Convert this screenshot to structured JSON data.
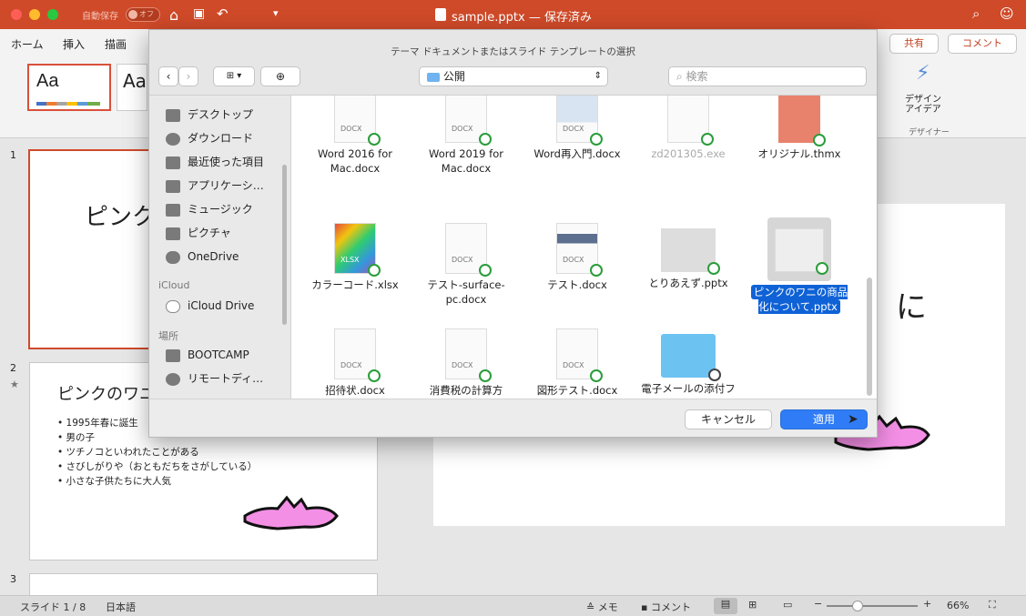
{
  "titlebar": {
    "autosave_label": "自動保存",
    "autosave_state": "オフ",
    "title": "sample.pptx — 保存済み"
  },
  "ribbon": {
    "tabs": [
      "ホーム",
      "挿入",
      "描画"
    ],
    "share": "共有",
    "comment": "コメント",
    "theme_sample": "Aa",
    "designer_label": "デザイン\nアイデア",
    "designer_group": "デザイナー"
  },
  "dialog": {
    "title": "テーマ ドキュメントまたはスライド テンプレートの選択",
    "location": "公開",
    "search_placeholder": "検索",
    "sidebar": {
      "favorites": [
        "デスクトップ",
        "ダウンロード",
        "最近使った項目",
        "アプリケーシ…",
        "ミュージック",
        "ピクチャ",
        "OneDrive"
      ],
      "icloud_title": "iCloud",
      "icloud": [
        "iCloud Drive"
      ],
      "places_title": "場所",
      "places": [
        "BOOTCAMP",
        "リモートディ…"
      ]
    },
    "files": [
      {
        "name": "Word 2016 for Mac.docx",
        "tag": "DOCX"
      },
      {
        "name": "Word 2019 for Mac.docx",
        "tag": "DOCX"
      },
      {
        "name": "Word再入門.docx",
        "tag": "DOCX"
      },
      {
        "name": "zd201305.exe",
        "tag": ""
      },
      {
        "name": "オリジナル.thmx",
        "tag": ""
      },
      {
        "name": "カラーコード.xlsx",
        "tag": "XLSX"
      },
      {
        "name": "テスト-surface-pc.docx",
        "tag": "DOCX"
      },
      {
        "name": "テスト.docx",
        "tag": "DOCX"
      },
      {
        "name": "とりあえず.pptx",
        "tag": ""
      },
      {
        "name": "ピンクのワニの商品化について.pptx",
        "tag": ""
      },
      {
        "name": "招待状.docx",
        "tag": "DOCX"
      },
      {
        "name": "消費税の計算方法.docx",
        "tag": "DOCX"
      },
      {
        "name": "図形テスト.docx",
        "tag": "DOCX"
      },
      {
        "name": "電子メールの添付ファイル",
        "tag": ""
      }
    ],
    "cancel": "キャンセル",
    "apply": "適用"
  },
  "slides": {
    "numbers": [
      "1",
      "2",
      "3"
    ],
    "slide1_title": "ピンク",
    "slide2_title": "ピンクのワニ",
    "slide2_bullets": [
      "1995年春に誕生",
      "男の子",
      "ツチノコといわれたことがある",
      "さびしがりや（おともだちをさがしている）",
      "小さな子供たちに大人気"
    ],
    "main_fragment": "に"
  },
  "status": {
    "slide": "スライド 1 / 8",
    "lang": "日本語",
    "notes": "メモ",
    "comments": "コメント",
    "zoom": "66%"
  }
}
